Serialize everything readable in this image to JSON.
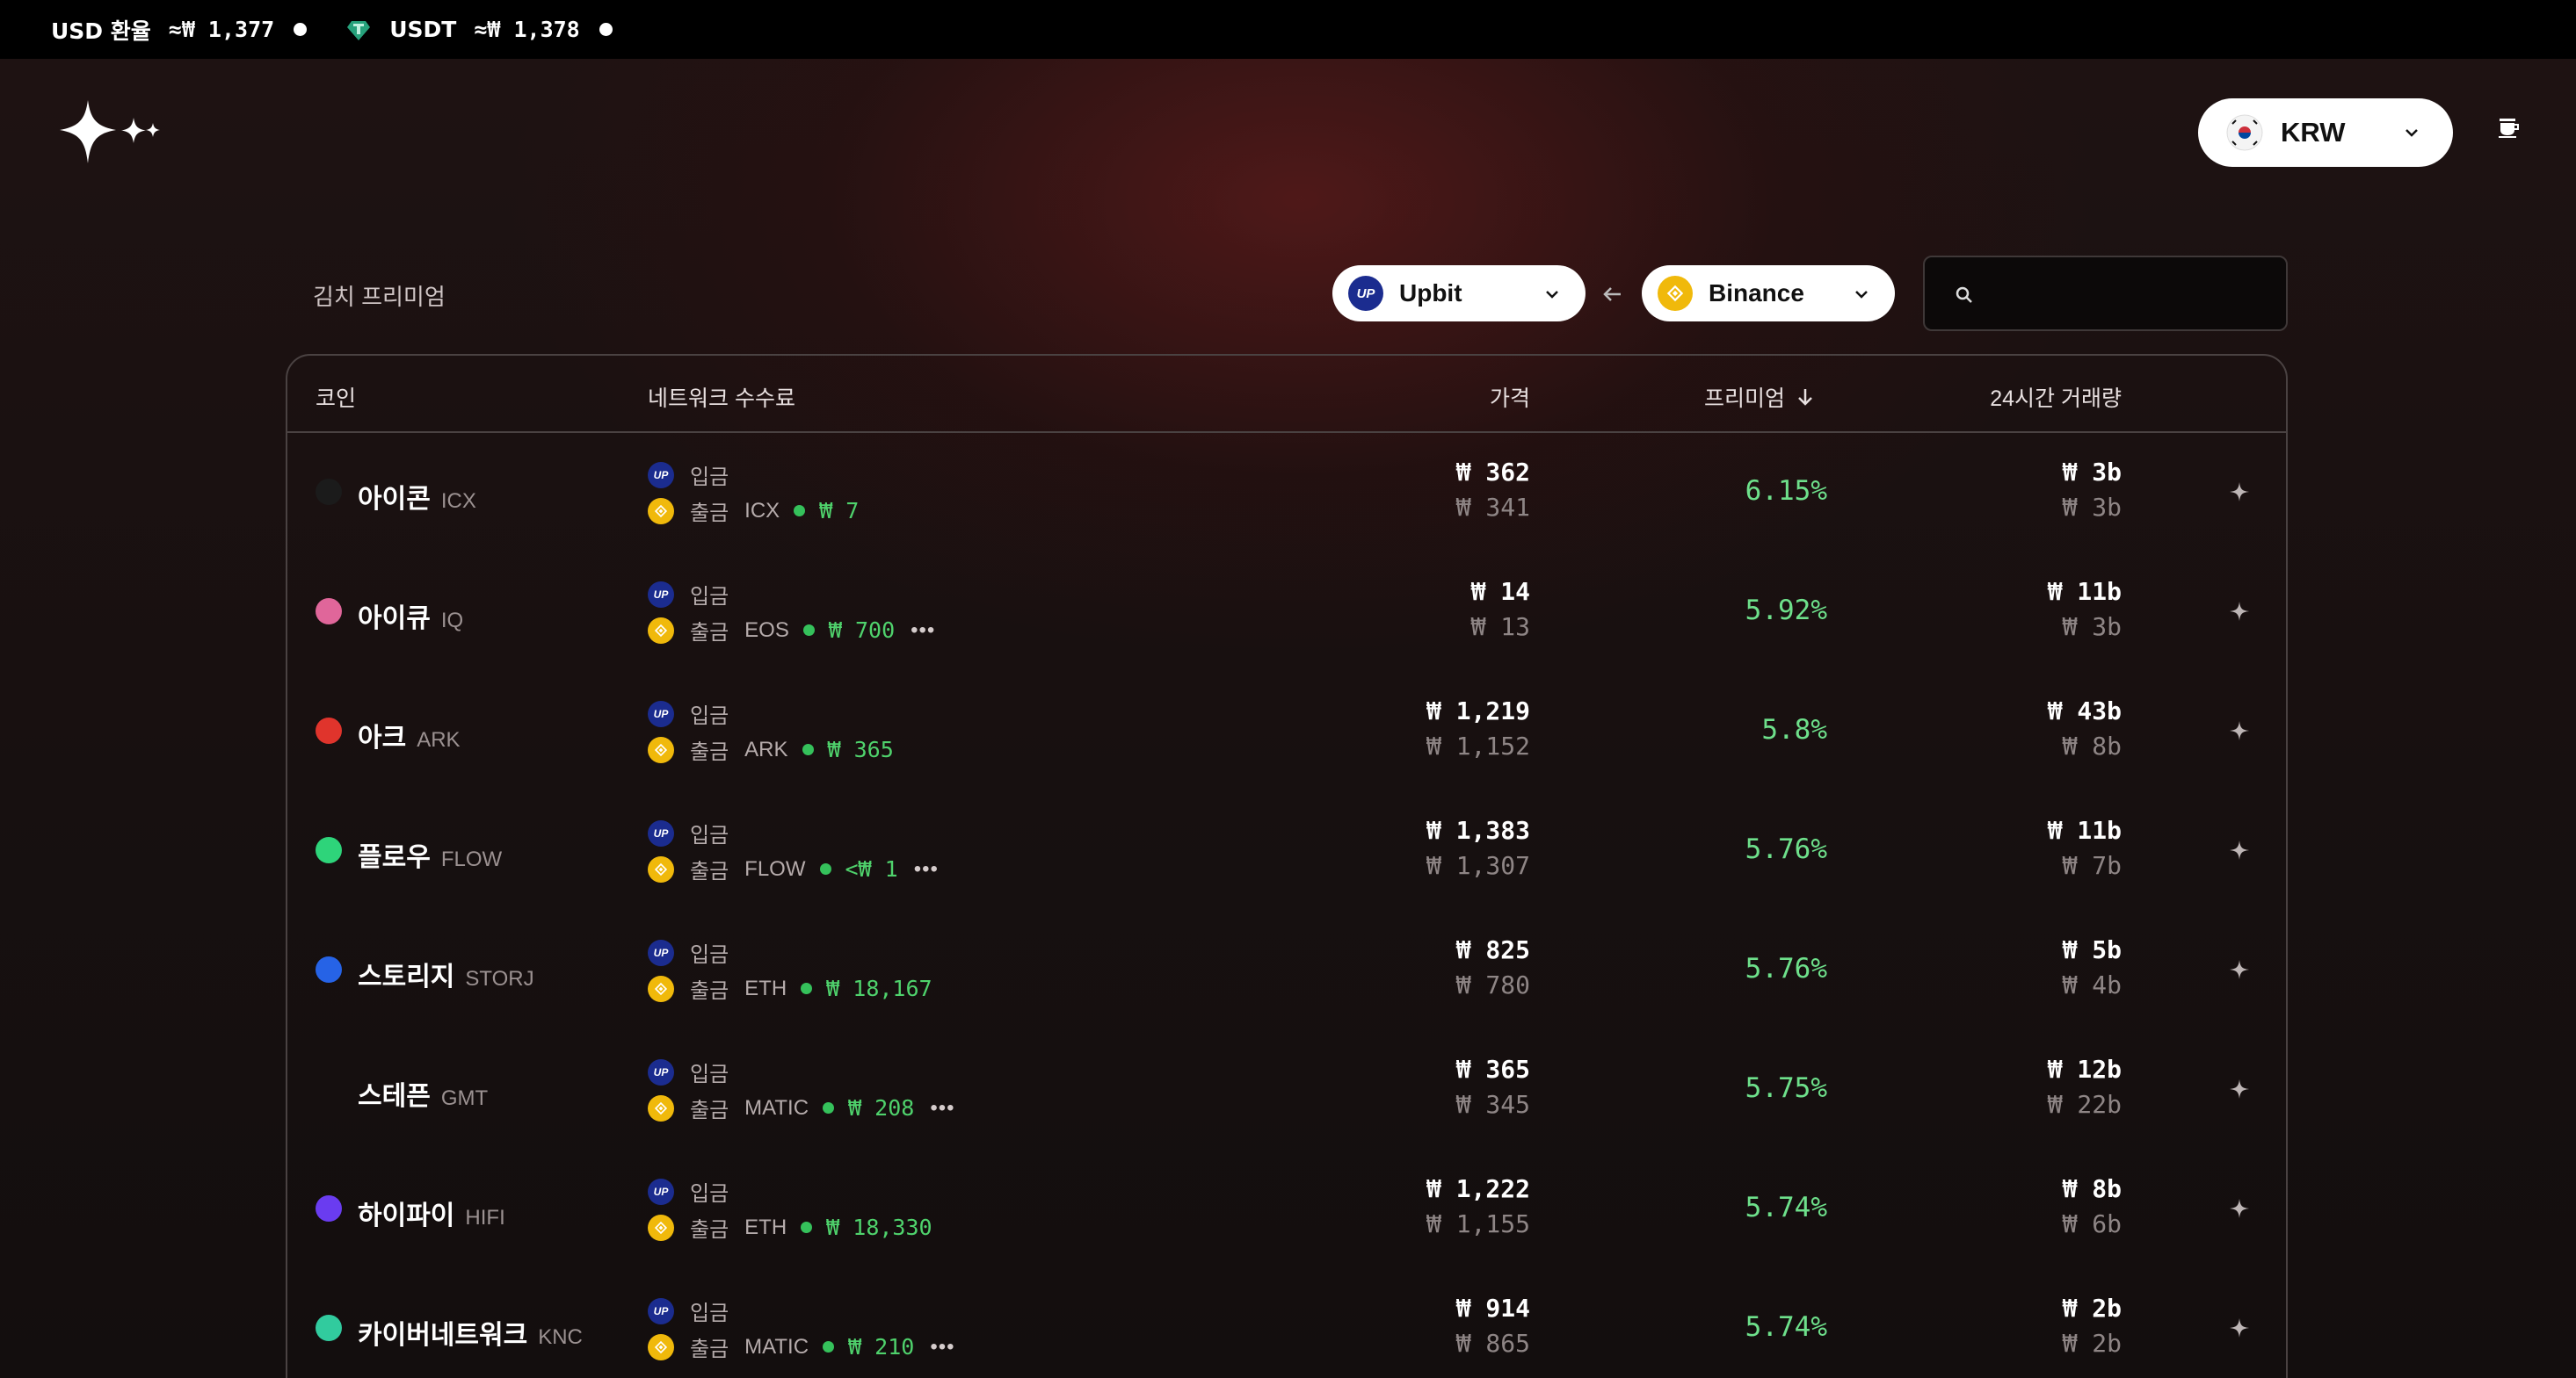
{
  "ticker": {
    "usd_label": "USD 환율",
    "usd_value": "≈₩ 1,377",
    "usdt_label": "USDT",
    "usdt_value": "≈₩ 1,378"
  },
  "header": {
    "currency": "KRW",
    "logo_icon": "sparkles-icon",
    "cup_icon": "coffee-cup-icon"
  },
  "section": {
    "title": "김치 프리미엄",
    "exchange_left": "Upbit",
    "exchange_right": "Binance",
    "search_placeholder": ""
  },
  "table": {
    "headers": {
      "coin": "코인",
      "network": "네트워크 수수료",
      "price": "가격",
      "premium": "프리미엄",
      "volume": "24시간 거래량"
    },
    "deposit_label": "입금",
    "withdraw_label": "출금",
    "rows": [
      {
        "name": "아이콘",
        "symbol": "ICX",
        "net": "ICX",
        "fee": "₩ 7",
        "more": false,
        "price1": "₩ 362",
        "price2": "₩ 341",
        "premium": "6.15%",
        "vol1": "₩ 3b",
        "vol2": "₩ 3b",
        "color": "#1b1b1b"
      },
      {
        "name": "아이큐",
        "symbol": "IQ",
        "net": "EOS",
        "fee": "₩ 700",
        "more": true,
        "price1": "₩ 14",
        "price2": "₩ 13",
        "premium": "5.92%",
        "vol1": "₩ 11b",
        "vol2": "₩ 3b",
        "color": "#e0669a"
      },
      {
        "name": "아크",
        "symbol": "ARK",
        "net": "ARK",
        "fee": "₩ 365",
        "more": false,
        "price1": "₩ 1,219",
        "price2": "₩ 1,152",
        "premium": "5.8%",
        "vol1": "₩ 43b",
        "vol2": "₩ 8b",
        "color": "#e0342c"
      },
      {
        "name": "플로우",
        "symbol": "FLOW",
        "net": "FLOW",
        "fee": "<₩ 1",
        "more": true,
        "price1": "₩ 1,383",
        "price2": "₩ 1,307",
        "premium": "5.76%",
        "vol1": "₩ 11b",
        "vol2": "₩ 7b",
        "color": "#2ed47a"
      },
      {
        "name": "스토리지",
        "symbol": "STORJ",
        "net": "ETH",
        "fee": "₩ 18,167",
        "more": false,
        "price1": "₩ 825",
        "price2": "₩ 780",
        "premium": "5.76%",
        "vol1": "₩ 5b",
        "vol2": "₩ 4b",
        "color": "#2663e6"
      },
      {
        "name": "스테픈",
        "symbol": "GMT",
        "net": "MATIC",
        "fee": "₩ 208",
        "more": true,
        "price1": "₩ 365",
        "price2": "₩ 345",
        "premium": "5.75%",
        "vol1": "₩ 12b",
        "vol2": "₩ 22b",
        "color": "transparent"
      },
      {
        "name": "하이파이",
        "symbol": "HIFI",
        "net": "ETH",
        "fee": "₩ 18,330",
        "more": false,
        "price1": "₩ 1,222",
        "price2": "₩ 1,155",
        "premium": "5.74%",
        "vol1": "₩ 8b",
        "vol2": "₩ 6b",
        "color": "#6a3cf0"
      },
      {
        "name": "카이버네트워크",
        "symbol": "KNC",
        "net": "MATIC",
        "fee": "₩ 210",
        "more": true,
        "price1": "₩ 914",
        "price2": "₩ 865",
        "premium": "5.74%",
        "vol1": "₩ 2b",
        "vol2": "₩ 2b",
        "color": "#31cb9e"
      }
    ]
  }
}
